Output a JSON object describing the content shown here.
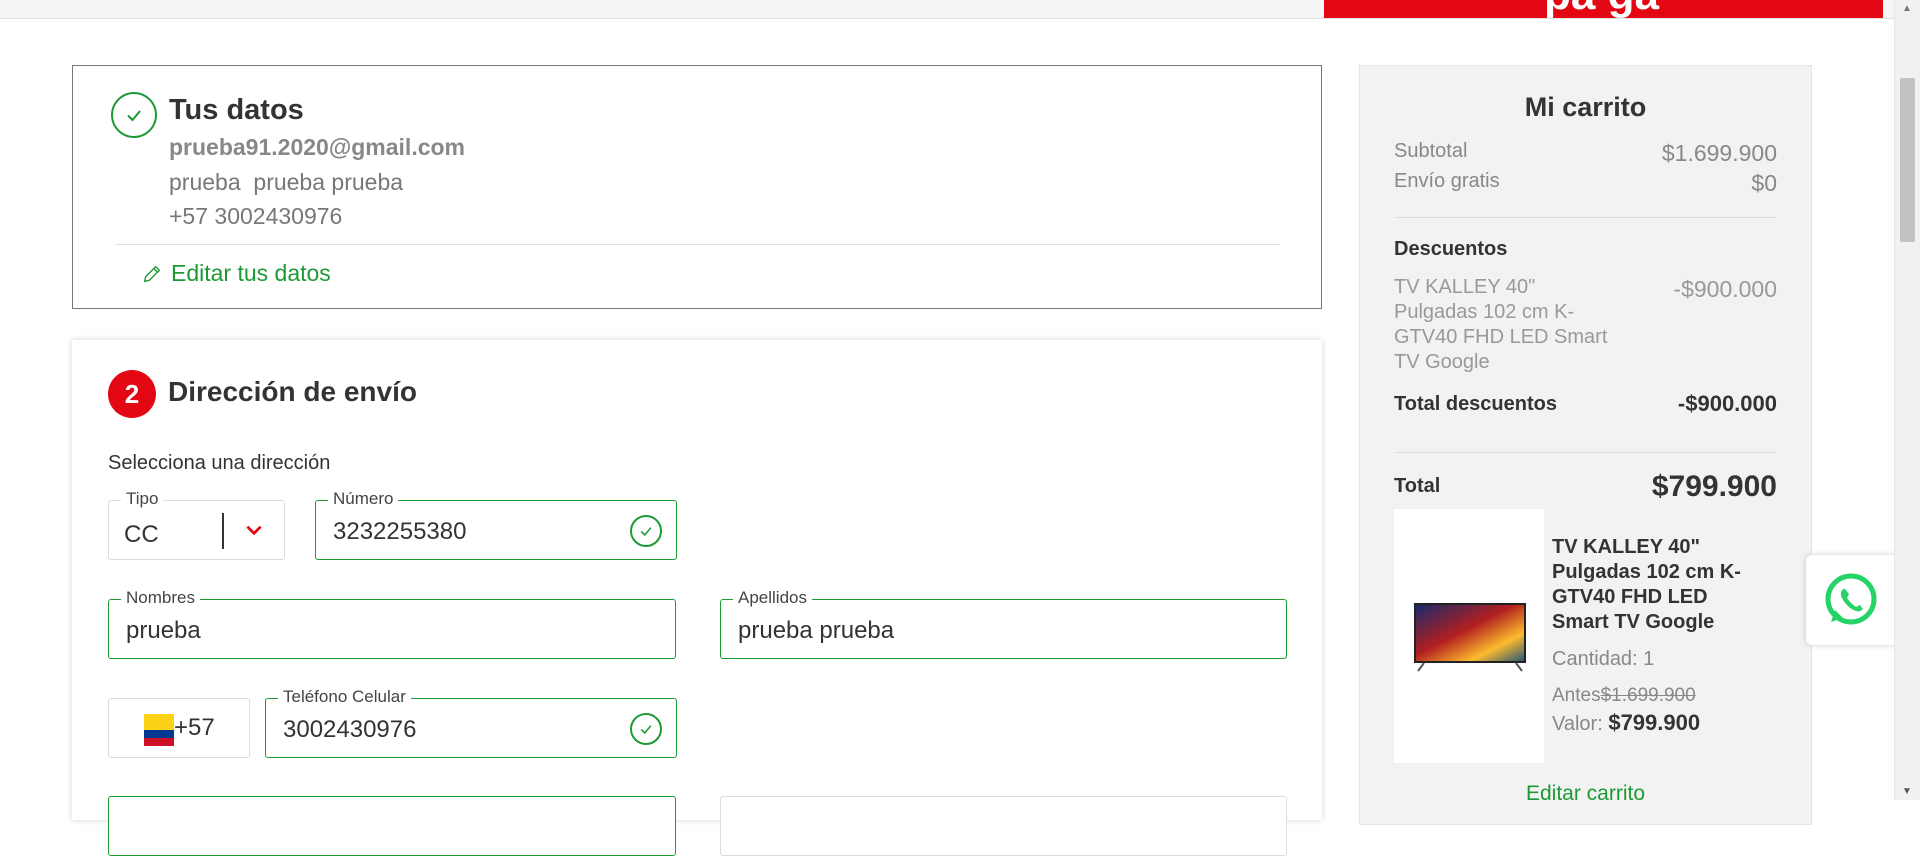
{
  "topbar": {
    "banner_text": "pa ga"
  },
  "tus_datos": {
    "title": "Tus datos",
    "email": "prueba91.2020@gmail.com",
    "name": "prueba  prueba prueba",
    "phone": "+57 3002430976",
    "edit_label": "Editar tus datos"
  },
  "shipping": {
    "step": "2",
    "title": "Dirección de envío",
    "subtitle": "Selecciona una dirección",
    "tipo": {
      "label": "Tipo",
      "value": "CC"
    },
    "numero": {
      "label": "Número",
      "value": "3232255380"
    },
    "nombres": {
      "label": "Nombres",
      "value": "prueba"
    },
    "apellidos": {
      "label": "Apellidos",
      "value": "prueba prueba"
    },
    "country_code": "+57",
    "telefono": {
      "label": "Teléfono Celular",
      "value": "3002430976"
    }
  },
  "cart": {
    "title": "Mi carrito",
    "subtotal_label": "Subtotal",
    "subtotal_value": "$1.699.900",
    "shipping_label": "Envío gratis",
    "shipping_value": "$0",
    "discounts_title": "Descuentos",
    "discount_item": "TV KALLEY 40\" Pulgadas 102 cm K-GTV40 FHD LED Smart TV Google",
    "discount_item_value": "-$900.000",
    "total_discounts_label": "Total descuentos",
    "total_discounts_value": "-$900.000",
    "total_label": "Total",
    "total_value": "$799.900",
    "product": {
      "name": "TV KALLEY 40\" Pulgadas 102 cm K-GTV40 FHD LED Smart TV Google",
      "quantity": "Cantidad: 1",
      "before_label": "Antes",
      "before_value": "$1.699.900",
      "value_label": "Valor: ",
      "value": "$799.900"
    },
    "edit_label": "Editar carrito"
  },
  "colors": {
    "accent_green": "#1d9a35",
    "brand_red": "#e30613"
  },
  "icons": [
    "check-circle-icon",
    "pencil-icon",
    "chevron-down-icon",
    "colombia-flag-icon",
    "whatsapp-icon"
  ]
}
